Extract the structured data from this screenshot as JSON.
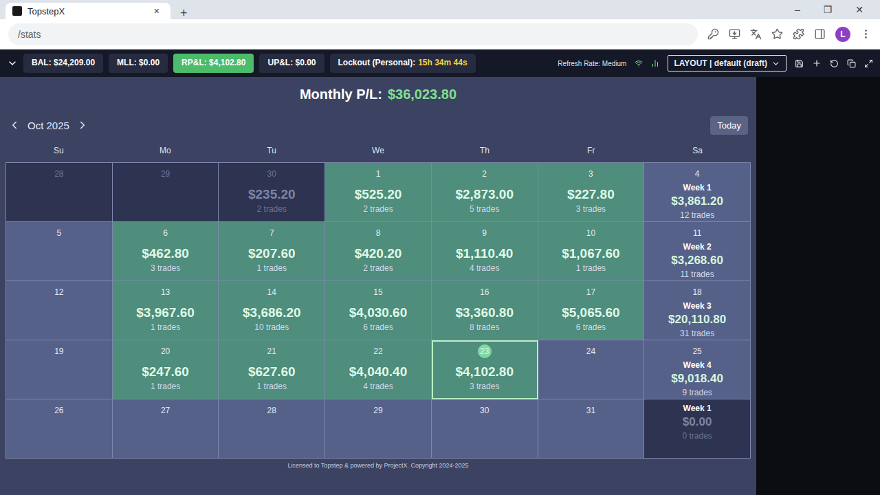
{
  "browser": {
    "tab_title": "TopstepX",
    "tab_close": "×",
    "new_tab": "+",
    "address": "/stats",
    "avatar": "L",
    "window_buttons": [
      "–",
      "❐",
      "✕"
    ]
  },
  "toolbar": {
    "stats": [
      {
        "label": "BAL: $24,209.00",
        "selected": false
      },
      {
        "label": "MLL: $0.00",
        "selected": false
      },
      {
        "label": "RP&L: $4,102.80",
        "selected": true
      },
      {
        "label": "UP&L: $0.00",
        "selected": false
      }
    ],
    "lockout": {
      "label": "Lockout (Personal):",
      "value": "15h 34m 44s"
    },
    "refresh": "Refresh Rate: Medium",
    "layout": "LAYOUT | default (draft)"
  },
  "calendar": {
    "monthly_label": "Monthly P/L:",
    "monthly_value": "$36,023.80",
    "month": "Oct 2025",
    "today": "Today",
    "weekdays": [
      "Su",
      "Mo",
      "Tu",
      "We",
      "Th",
      "Fr",
      "Sa"
    ],
    "weeks": [
      [
        {
          "kind": "day",
          "date": "28",
          "outside": true,
          "profit": false,
          "selected": false
        },
        {
          "kind": "day",
          "date": "29",
          "outside": true,
          "profit": false,
          "selected": false
        },
        {
          "kind": "day",
          "date": "30",
          "amount": "$235.20",
          "trades": "2 trades",
          "outside": true,
          "profit": true,
          "selected": false
        },
        {
          "kind": "day",
          "date": "1",
          "amount": "$525.20",
          "trades": "2 trades",
          "outside": false,
          "profit": true,
          "selected": false
        },
        {
          "kind": "day",
          "date": "2",
          "amount": "$2,873.00",
          "trades": "5 trades",
          "outside": false,
          "profit": true,
          "selected": false
        },
        {
          "kind": "day",
          "date": "3",
          "amount": "$227.80",
          "trades": "3 trades",
          "outside": false,
          "profit": true,
          "selected": false
        },
        {
          "kind": "week",
          "date": "4",
          "week": "Week 1",
          "amount": "$3,861.20",
          "trades": "12 trades",
          "outside": false,
          "profit": false,
          "selected": false
        }
      ],
      [
        {
          "kind": "day",
          "date": "5",
          "outside": false,
          "profit": false,
          "selected": false
        },
        {
          "kind": "day",
          "date": "6",
          "amount": "$462.80",
          "trades": "3 trades",
          "outside": false,
          "profit": true,
          "selected": false
        },
        {
          "kind": "day",
          "date": "7",
          "amount": "$207.60",
          "trades": "1 trades",
          "outside": false,
          "profit": true,
          "selected": false
        },
        {
          "kind": "day",
          "date": "8",
          "amount": "$420.20",
          "trades": "2 trades",
          "outside": false,
          "profit": true,
          "selected": false
        },
        {
          "kind": "day",
          "date": "9",
          "amount": "$1,110.40",
          "trades": "4 trades",
          "outside": false,
          "profit": true,
          "selected": false
        },
        {
          "kind": "day",
          "date": "10",
          "amount": "$1,067.60",
          "trades": "1 trades",
          "outside": false,
          "profit": true,
          "selected": false
        },
        {
          "kind": "week",
          "date": "11",
          "week": "Week 2",
          "amount": "$3,268.60",
          "trades": "11 trades",
          "outside": false,
          "profit": false,
          "selected": false
        }
      ],
      [
        {
          "kind": "day",
          "date": "12",
          "outside": false,
          "profit": false,
          "selected": false
        },
        {
          "kind": "day",
          "date": "13",
          "amount": "$3,967.60",
          "trades": "1 trades",
          "outside": false,
          "profit": true,
          "selected": false
        },
        {
          "kind": "day",
          "date": "14",
          "amount": "$3,686.20",
          "trades": "10 trades",
          "outside": false,
          "profit": true,
          "selected": false
        },
        {
          "kind": "day",
          "date": "15",
          "amount": "$4,030.60",
          "trades": "6 trades",
          "outside": false,
          "profit": true,
          "selected": false
        },
        {
          "kind": "day",
          "date": "16",
          "amount": "$3,360.80",
          "trades": "8 trades",
          "outside": false,
          "profit": true,
          "selected": false
        },
        {
          "kind": "day",
          "date": "17",
          "amount": "$5,065.60",
          "trades": "6 trades",
          "outside": false,
          "profit": true,
          "selected": false
        },
        {
          "kind": "week",
          "date": "18",
          "week": "Week 3",
          "amount": "$20,110.80",
          "trades": "31 trades",
          "outside": false,
          "profit": false,
          "selected": false
        }
      ],
      [
        {
          "kind": "day",
          "date": "19",
          "outside": false,
          "profit": false,
          "selected": false
        },
        {
          "kind": "day",
          "date": "20",
          "amount": "$247.60",
          "trades": "1 trades",
          "outside": false,
          "profit": true,
          "selected": false
        },
        {
          "kind": "day",
          "date": "21",
          "amount": "$627.60",
          "trades": "1 trades",
          "outside": false,
          "profit": true,
          "selected": false
        },
        {
          "kind": "day",
          "date": "22",
          "amount": "$4,040.40",
          "trades": "4 trades",
          "outside": false,
          "profit": true,
          "selected": false
        },
        {
          "kind": "day",
          "date": "23",
          "amount": "$4,102.80",
          "trades": "3 trades",
          "outside": false,
          "profit": true,
          "selected": true
        },
        {
          "kind": "day",
          "date": "24",
          "outside": false,
          "profit": false,
          "selected": false
        },
        {
          "kind": "week",
          "date": "25",
          "week": "Week 4",
          "amount": "$9,018.40",
          "trades": "9 trades",
          "outside": false,
          "profit": false,
          "selected": false
        }
      ],
      [
        {
          "kind": "day",
          "date": "26",
          "outside": false,
          "profit": false,
          "selected": false
        },
        {
          "kind": "day",
          "date": "27",
          "outside": false,
          "profit": false,
          "selected": false
        },
        {
          "kind": "day",
          "date": "28",
          "outside": false,
          "profit": false,
          "selected": false
        },
        {
          "kind": "day",
          "date": "29",
          "outside": false,
          "profit": false,
          "selected": false
        },
        {
          "kind": "day",
          "date": "30",
          "outside": false,
          "profit": false,
          "selected": false
        },
        {
          "kind": "day",
          "date": "31",
          "outside": false,
          "profit": false,
          "selected": false
        },
        {
          "kind": "week",
          "week": "Week 1",
          "amount": "$0.00",
          "trades": "0 trades",
          "outside": true,
          "profit": false,
          "selected": false
        }
      ]
    ]
  },
  "footer": "Licensed to Topstep & powered by ProjectX. Copyright 2024-2025"
}
